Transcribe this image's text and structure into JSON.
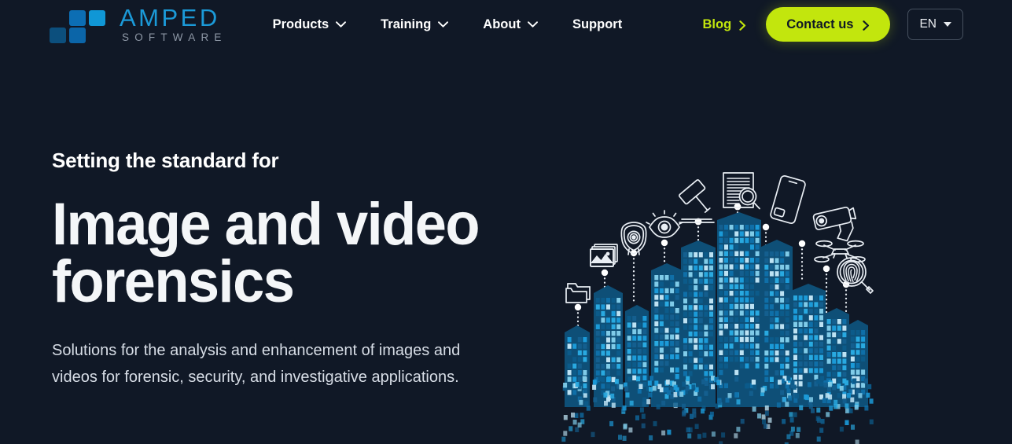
{
  "theme": {
    "background": "#101826",
    "accent_green": "#c2e60d",
    "logo_blue": "#1b9ad8",
    "building_blue": "#1b9ad8",
    "text_primary": "#ffffff",
    "text_muted": "#8e98a6"
  },
  "header": {
    "logo": {
      "wordmark": "AMPED",
      "subword": "SOFTWARE",
      "squares": [
        "#0c6eb4",
        "#1097d6",
        "#0c4f7d",
        "#0b65a8"
      ]
    },
    "nav": [
      {
        "label": "Products",
        "has_dropdown": true,
        "icon": "chevron-down-icon"
      },
      {
        "label": "Training",
        "has_dropdown": true,
        "icon": "chevron-down-icon"
      },
      {
        "label": "About",
        "has_dropdown": true,
        "icon": "chevron-down-icon"
      },
      {
        "label": "Support",
        "has_dropdown": false,
        "icon": ""
      }
    ],
    "blog": {
      "label": "Blog",
      "icon": "chevron-right-icon"
    },
    "contact": {
      "label": "Contact us",
      "icon": "chevron-right-icon"
    },
    "language": {
      "label": "EN",
      "icon": "caret-down-icon"
    }
  },
  "hero": {
    "eyebrow": "Setting the standard for",
    "headline_line1": "Image and video",
    "headline_line2": "forensics",
    "subcopy": "Solutions for the analysis and enhancement of images and videos for forensic, security, and investigative applications."
  },
  "illustration": {
    "name": "forensic-city-skyline",
    "description": "Pixelated blue city skyline dissolving into pixels, with white line-art forensic icons on dotted pins above the buildings",
    "icons": [
      {
        "name": "folder-icon",
        "label": "Folder"
      },
      {
        "name": "photos-icon",
        "label": "Images"
      },
      {
        "name": "police-badge-icon",
        "label": "Police badge"
      },
      {
        "name": "eye-icon",
        "label": "Eye"
      },
      {
        "name": "gavel-icon",
        "label": "Gavel"
      },
      {
        "name": "document-search-icon",
        "label": "Document analysis"
      },
      {
        "name": "smartphone-icon",
        "label": "Mobile phone"
      },
      {
        "name": "cctv-camera-icon",
        "label": "CCTV camera"
      },
      {
        "name": "drone-icon",
        "label": "Drone"
      },
      {
        "name": "fingerprint-search-icon",
        "label": "Fingerprint"
      }
    ]
  }
}
